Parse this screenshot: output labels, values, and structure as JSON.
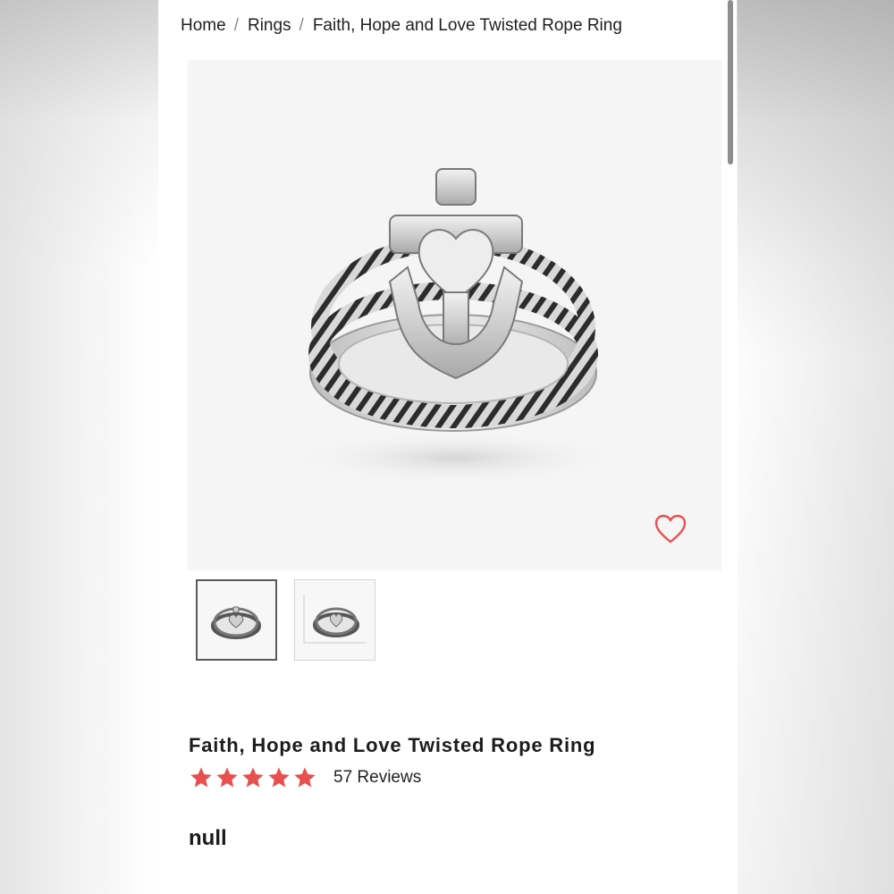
{
  "breadcrumb": {
    "items": [
      "Home",
      "Rings",
      "Faith, Hope and Love Twisted Rope Ring"
    ],
    "separator": "/"
  },
  "product": {
    "title": "Faith, Hope and Love Twisted Rope Ring",
    "rating": 5,
    "rating_max": 5,
    "reviews_label": "57 Reviews",
    "price": "null"
  },
  "gallery": {
    "main_image_icon": "anchor-heart-ring-image",
    "thumbnails": [
      "ring-thumbnail",
      "ring-size-chart-thumbnail"
    ],
    "selected_thumbnail": 1
  },
  "icons": {
    "wishlist": "heart-outline-icon",
    "star": "star-icon"
  },
  "colors": {
    "accent": "#e8504f",
    "text": "#1f1f1f",
    "image_background": "#f5f5f5",
    "thumbnail_border_selected": "#5a5a5a"
  }
}
